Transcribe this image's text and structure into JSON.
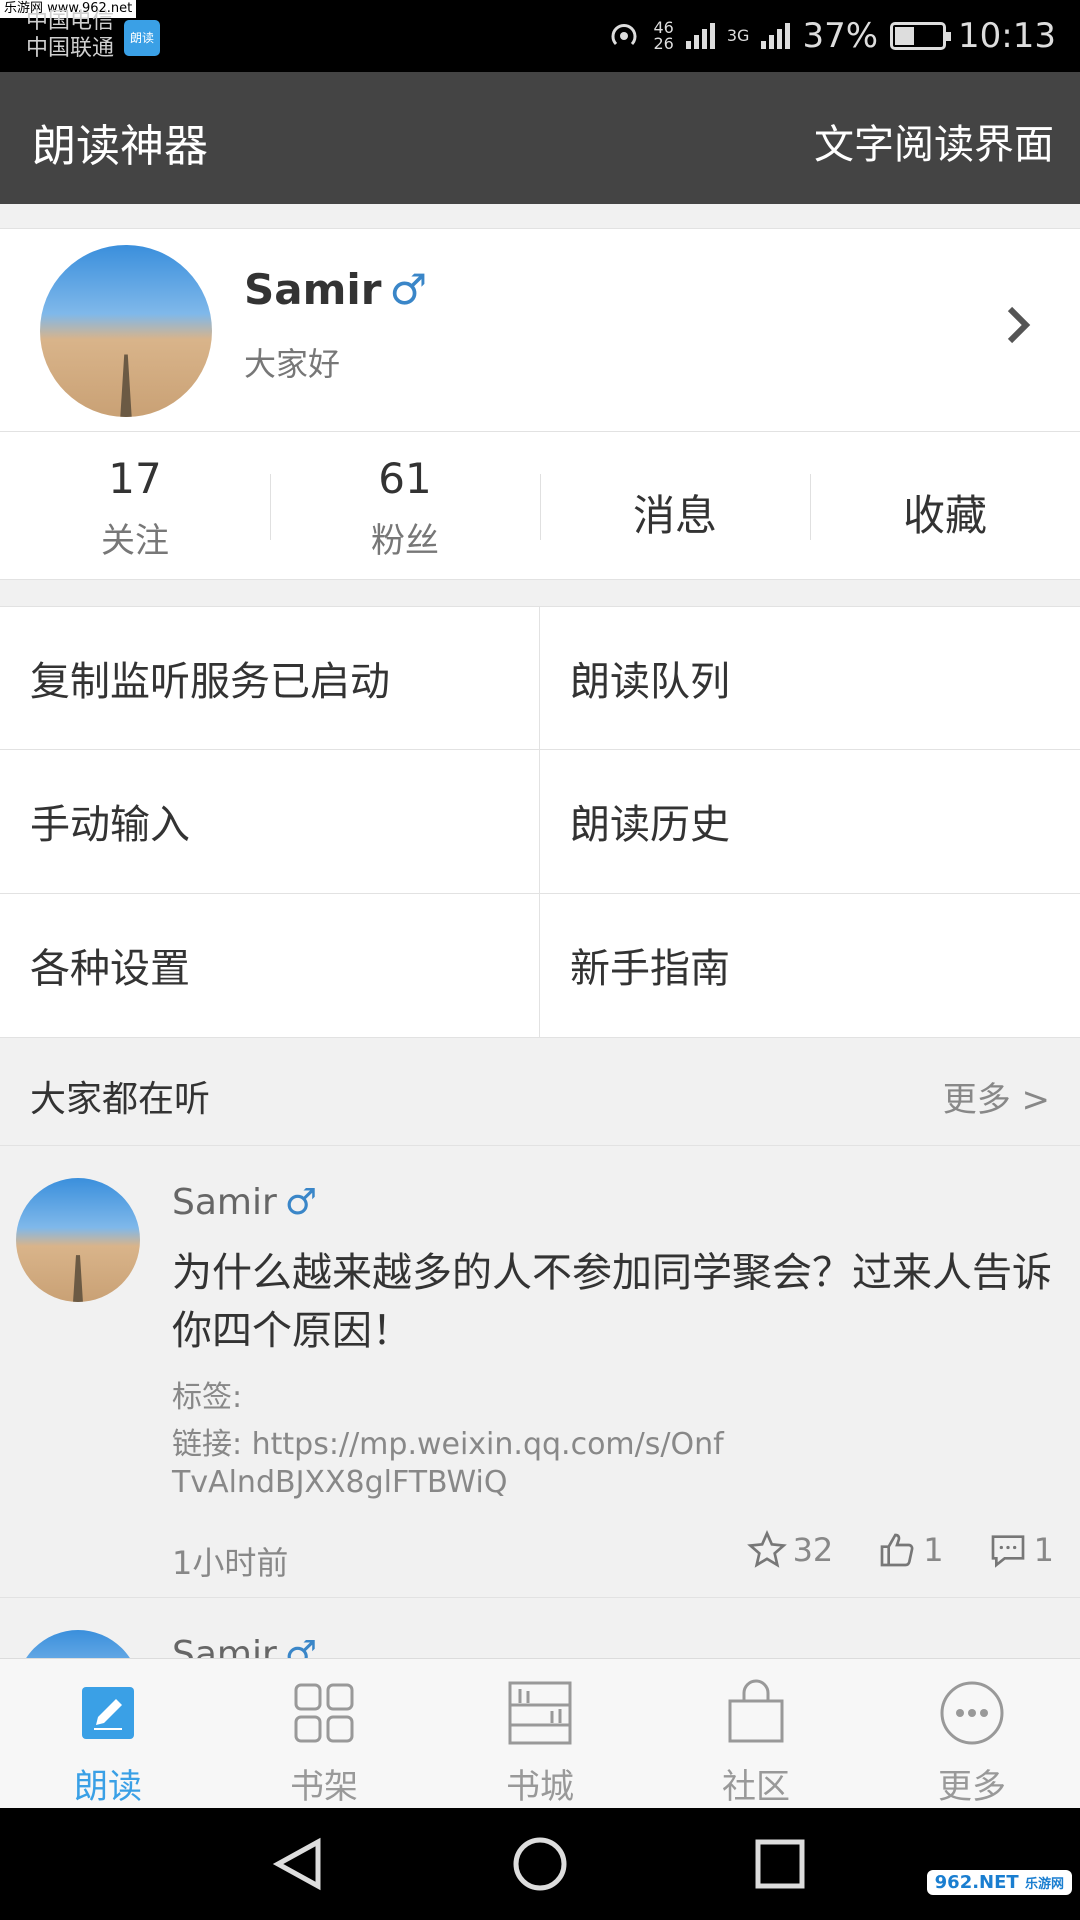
{
  "status_bar": {
    "watermark": "乐游网 www.962.net",
    "carrier1": "中国电信",
    "carrier2": "中国联通",
    "app_icon_text": "朗读",
    "net_small_top": "46",
    "net_small_bottom": "26",
    "net_3g": "3G",
    "battery_percent": "37%",
    "battery_level": 0.37,
    "time": "10:13"
  },
  "appbar": {
    "title": "朗读神器",
    "action": "文字阅读界面"
  },
  "profile": {
    "username": "Samir",
    "gender_symbol": "♂",
    "bio": "大家好"
  },
  "stats": {
    "following_count": "17",
    "following_label": "关注",
    "fans_count": "61",
    "fans_label": "粉丝",
    "messages": "消息",
    "favorites": "收藏"
  },
  "menu": {
    "items": [
      {
        "label": "复制监听服务已启动"
      },
      {
        "label": "朗读队列"
      },
      {
        "label": "手动输入"
      },
      {
        "label": "朗读历史"
      },
      {
        "label": "各种设置"
      },
      {
        "label": "新手指南"
      }
    ]
  },
  "section": {
    "title": "大家都在听",
    "more": "更多 >"
  },
  "post": {
    "author": "Samir",
    "gender_symbol": "♂",
    "title": "为什么越来越多的人不参加同学聚会？过来人告诉你四个原因！",
    "tags": "标签:",
    "link": "链接: https://mp.weixin.qq.com/s/OnfTvAlndBJXX8glFTBWiQ",
    "time": "1小时前",
    "star_count": "32",
    "like_count": "1",
    "comment_count": "1"
  },
  "post2": {
    "author": "Samir",
    "gender_symbol": "♂"
  },
  "tabs": [
    {
      "label": "朗读",
      "icon": "edit-icon"
    },
    {
      "label": "书架",
      "icon": "grid-icon"
    },
    {
      "label": "书城",
      "icon": "bookstore-icon"
    },
    {
      "label": "社区",
      "icon": "bag-icon"
    },
    {
      "label": "更多",
      "icon": "more-icon"
    }
  ],
  "colors": {
    "appbar_bg": "#444444",
    "accent": "#3aa0e6",
    "gender_blue": "#3a86c8"
  },
  "navbar_badge": {
    "brand_num": "962",
    "brand_net": ".NET",
    "brand_sub": "乐游网"
  }
}
